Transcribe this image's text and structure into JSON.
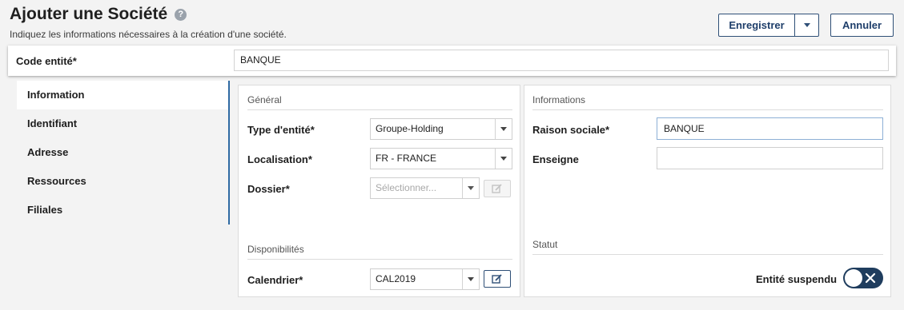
{
  "header": {
    "title": "Ajouter une Société",
    "subtitle": "Indiquez les informations nécessaires à la création d'une société.",
    "help_icon": "?"
  },
  "toolbar": {
    "save_label": "Enregistrer",
    "cancel_label": "Annuler"
  },
  "code_entite": {
    "label": "Code entité*",
    "value": "BANQUE"
  },
  "sidebar": {
    "items": [
      {
        "label": "Information",
        "active": true
      },
      {
        "label": "Identifiant"
      },
      {
        "label": "Adresse"
      },
      {
        "label": "Ressources"
      },
      {
        "label": "Filiales"
      }
    ]
  },
  "general": {
    "section_title": "Général",
    "type_entite": {
      "label": "Type d'entité*",
      "value": "Groupe-Holding"
    },
    "localisation": {
      "label": "Localisation*",
      "value": "FR - FRANCE"
    },
    "dossier": {
      "label": "Dossier*",
      "placeholder": "Sélectionner..."
    }
  },
  "disponibilites": {
    "section_title": "Disponibilités",
    "calendrier": {
      "label": "Calendrier*",
      "value": "CAL2019"
    }
  },
  "informations": {
    "section_title": "Informations",
    "raison_sociale": {
      "label": "Raison sociale*",
      "value": "BANQUE"
    },
    "enseigne": {
      "label": "Enseigne",
      "value": ""
    }
  },
  "statut": {
    "section_title": "Statut",
    "entite_suspendu": {
      "label": "Entité suspendu",
      "checked": false
    }
  },
  "colors": {
    "accent": "#2f4f77",
    "toggle_bg": "#1f3d5e",
    "active_tab_rule": "#2f6aa3"
  }
}
